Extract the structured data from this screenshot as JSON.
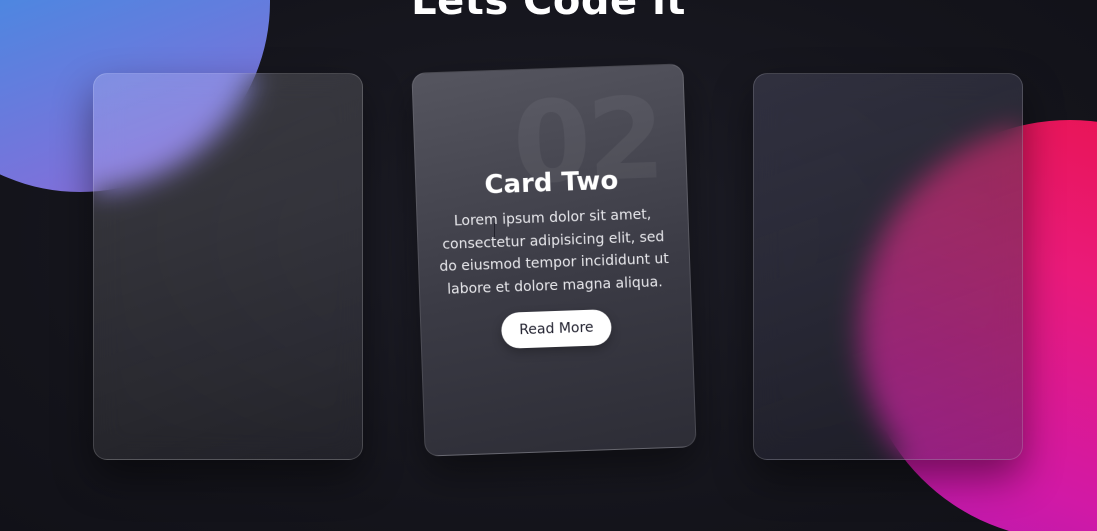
{
  "page": {
    "title": "Lets Code it"
  },
  "cards": [
    {
      "number": "",
      "title": "",
      "text": "",
      "button_label": ""
    },
    {
      "number": "02",
      "title": "Card Two",
      "text": "Lorem ipsum dolor sit amet, consectetur adipisicing elit, sed do eiusmod tempor incididunt ut labore et dolore magna aliqua.",
      "button_label": "Read More"
    },
    {
      "number": "",
      "title": "",
      "text": "",
      "button_label": ""
    }
  ],
  "colors": {
    "background": "#15151d",
    "blob_blue": "#2aa0ea",
    "blob_purple": "#8f69d8",
    "blob_pink": "#e8134a",
    "blob_magenta": "#d119a6",
    "button_bg": "#ffffff",
    "button_text": "#222230"
  }
}
